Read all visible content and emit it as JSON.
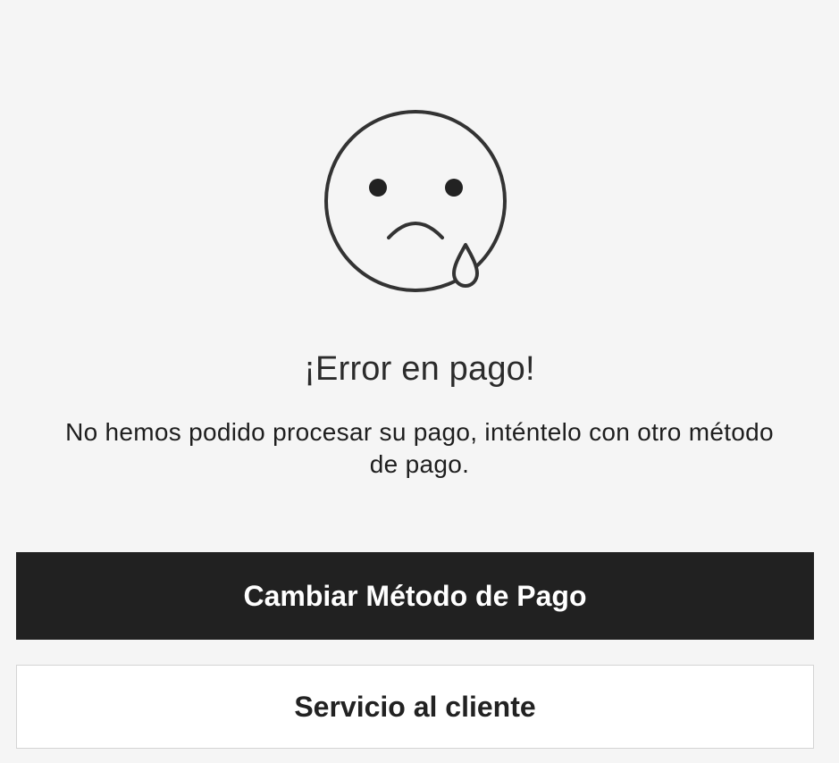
{
  "error": {
    "icon": "sad-face-tear-icon",
    "title": "¡Error en pago!",
    "message": "No hemos podido procesar su pago, inténtelo con otro método de pago."
  },
  "actions": {
    "change_method_label": "Cambiar Método de Pago",
    "customer_service_label": "Servicio al cliente"
  },
  "colors": {
    "background": "#f5f5f5",
    "primary_button": "#212121",
    "primary_button_text": "#ffffff",
    "secondary_button": "#ffffff",
    "icon_stroke": "#333333"
  }
}
